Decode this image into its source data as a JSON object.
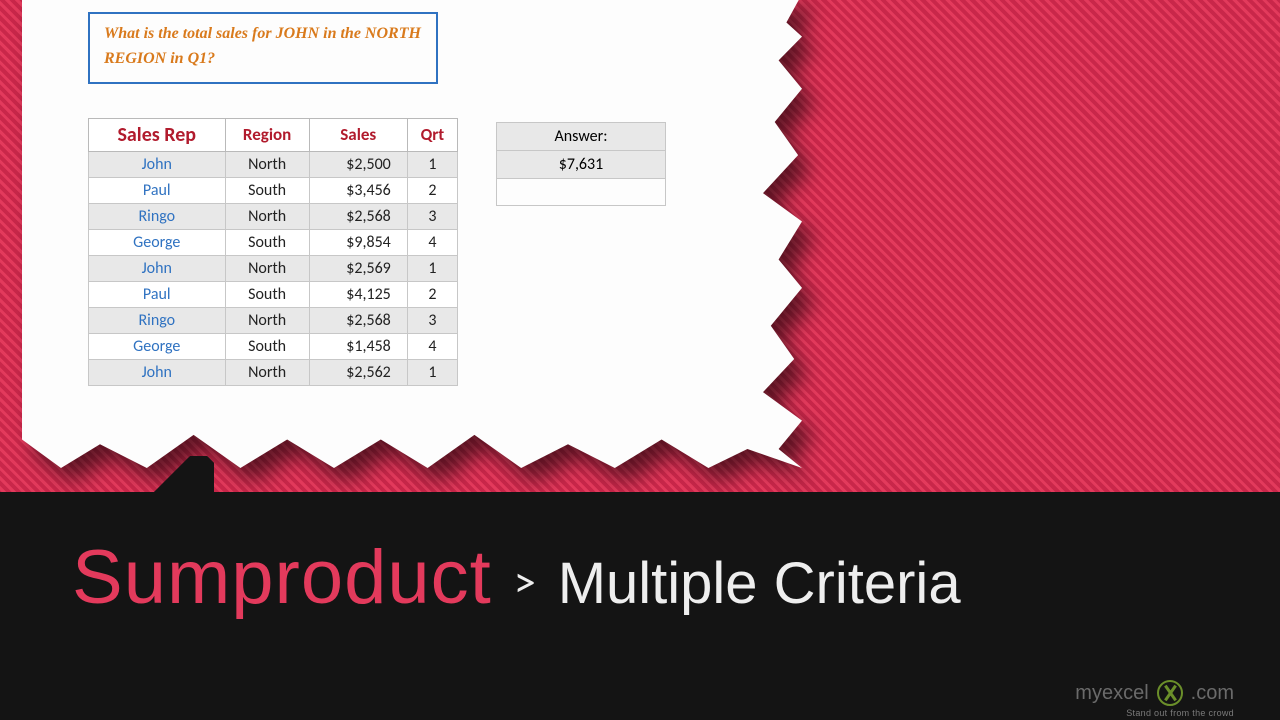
{
  "question": "What is the total sales for JOHN in the NORTH REGION in Q1?",
  "table": {
    "headers": {
      "rep": "Sales Rep",
      "region": "Region",
      "sales": "Sales",
      "qrt": "Qrt"
    },
    "rows": [
      {
        "rep": "John",
        "region": "North",
        "sales": "$2,500",
        "qrt": "1",
        "shade": true
      },
      {
        "rep": "Paul",
        "region": "South",
        "sales": "$3,456",
        "qrt": "2",
        "shade": false
      },
      {
        "rep": "Ringo",
        "region": "North",
        "sales": "$2,568",
        "qrt": "3",
        "shade": true
      },
      {
        "rep": "George",
        "region": "South",
        "sales": "$9,854",
        "qrt": "4",
        "shade": false
      },
      {
        "rep": "John",
        "region": "North",
        "sales": "$2,569",
        "qrt": "1",
        "shade": true
      },
      {
        "rep": "Paul",
        "region": "South",
        "sales": "$4,125",
        "qrt": "2",
        "shade": false
      },
      {
        "rep": "Ringo",
        "region": "North",
        "sales": "$2,568",
        "qrt": "3",
        "shade": true
      },
      {
        "rep": "George",
        "region": "South",
        "sales": "$1,458",
        "qrt": "4",
        "shade": false
      },
      {
        "rep": "John",
        "region": "North",
        "sales": "$2,562",
        "qrt": "1",
        "shade": true
      }
    ]
  },
  "answer": {
    "label": "Answer:",
    "value": "$7,631"
  },
  "title": {
    "main": "Sumproduct",
    "separator": ">",
    "sub": "Multiple Criteria"
  },
  "brand": {
    "text_left": "myexcel",
    "text_right": ".com",
    "tagline": "Stand out from the crowd"
  }
}
